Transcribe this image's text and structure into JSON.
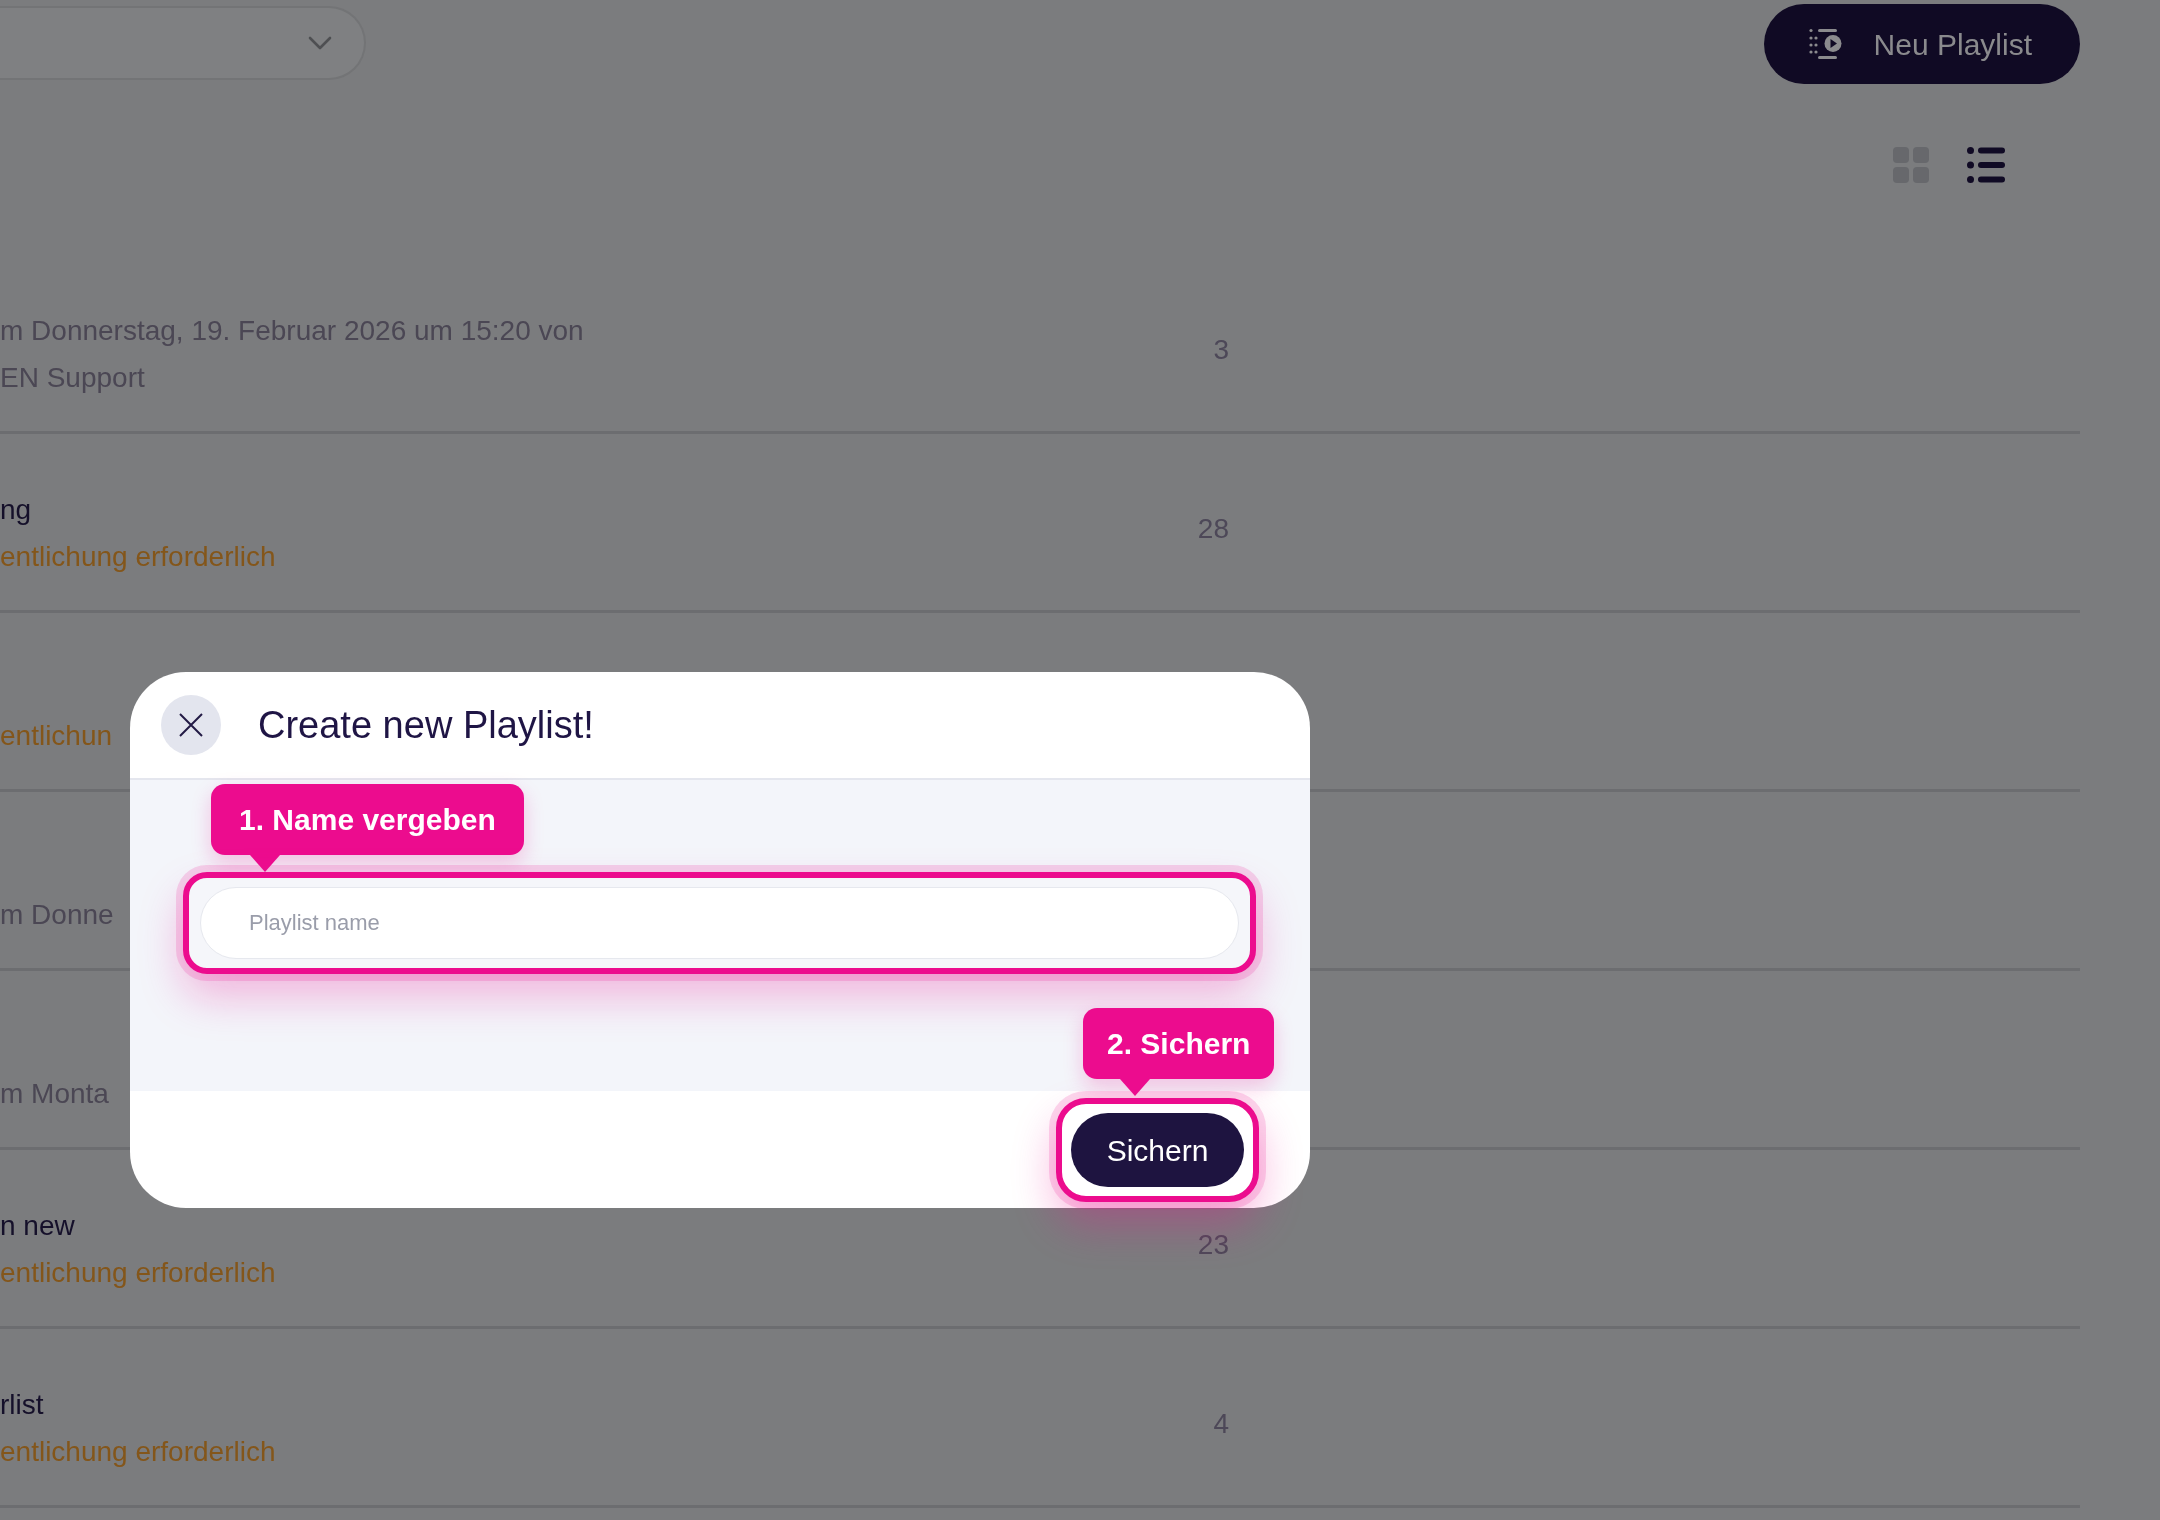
{
  "toolbar": {
    "new_button": {
      "label": "Neu Playlist"
    },
    "view_toggles": [
      {
        "kind": "grid",
        "selected": false
      },
      {
        "kind": "list",
        "selected": true
      }
    ]
  },
  "playlists": [
    {
      "lines": [
        {
          "kind": "meta",
          "text": "m Donnerstag, 19. Februar 2026 um 15:20 von"
        },
        {
          "kind": "meta",
          "text": "EN Support"
        }
      ],
      "count": "3"
    },
    {
      "lines": [
        {
          "kind": "title",
          "text": "ng"
        },
        {
          "kind": "warning",
          "text": "entlichung erforderlich"
        }
      ],
      "count": "28"
    },
    {
      "lines": [
        {
          "kind": "warning",
          "text": "entlichun"
        }
      ]
    },
    {
      "lines": [
        {
          "kind": "meta",
          "text": "m Donne"
        }
      ]
    },
    {
      "lines": [
        {
          "kind": "meta",
          "text": "m Monta"
        }
      ]
    },
    {
      "lines": [
        {
          "kind": "title",
          "text": "n new"
        },
        {
          "kind": "warning",
          "text": "entlichung erforderlich"
        }
      ],
      "count": "23"
    },
    {
      "lines": [
        {
          "kind": "title",
          "text": "rlist"
        },
        {
          "kind": "warning",
          "text": "entlichung erforderlich"
        }
      ],
      "count": "4"
    }
  ],
  "modal": {
    "title": "Create new Playlist!",
    "steps": [
      {
        "label": "1. Name vergeben"
      },
      {
        "label": "2. Sichern"
      }
    ],
    "name_field": {
      "placeholder": "Playlist name"
    },
    "save_button": {
      "label": "Sichern"
    }
  }
}
